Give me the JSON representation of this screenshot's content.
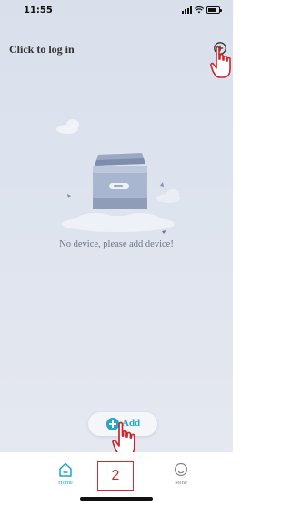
{
  "status_bar": {
    "time": "11:55"
  },
  "header": {
    "login_text": "Click to log in",
    "add_icon": "plus-circle-icon"
  },
  "empty_state": {
    "illustration": "empty-box-icon",
    "message": "No device, please add device!"
  },
  "add_button": {
    "label": "Add",
    "icon": "plus-circle-icon"
  },
  "tab_bar": {
    "tabs": [
      {
        "label": "Home",
        "icon": "home-icon",
        "active": true
      },
      {
        "label": "Mine",
        "icon": "profile-icon",
        "active": false
      }
    ]
  },
  "annotation": {
    "step_number": "2"
  },
  "colors": {
    "accent": "#26a7c3",
    "annotation_red": "#d4282e",
    "hand_outline": "#c9252b"
  }
}
